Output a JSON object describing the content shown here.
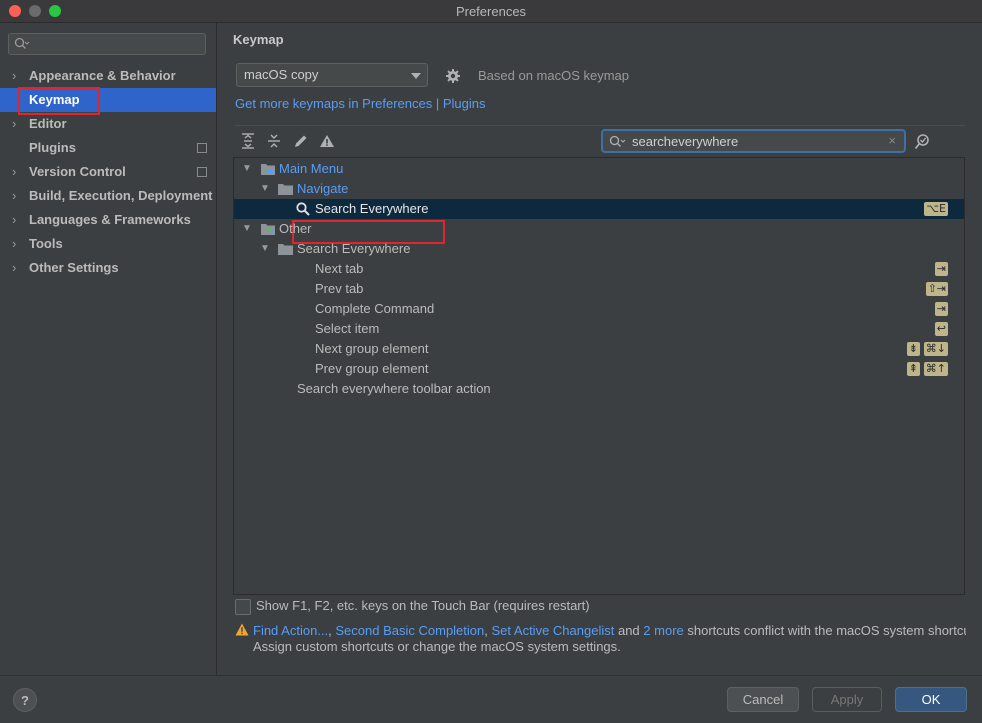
{
  "window": {
    "title": "Preferences"
  },
  "sidebar": {
    "search_placeholder": "",
    "items": [
      {
        "label": "Appearance & Behavior",
        "expandable": true
      },
      {
        "label": "Keymap",
        "selected": true
      },
      {
        "label": "Editor",
        "expandable": true
      },
      {
        "label": "Plugins",
        "external": true
      },
      {
        "label": "Version Control",
        "expandable": true,
        "external": true
      },
      {
        "label": "Build, Execution, Deployment",
        "expandable": true
      },
      {
        "label": "Languages & Frameworks",
        "expandable": true
      },
      {
        "label": "Tools",
        "expandable": true
      },
      {
        "label": "Other Settings",
        "expandable": true
      }
    ]
  },
  "keymap": {
    "heading": "Keymap",
    "selected_keymap": "macOS copy",
    "based_on": "Based on macOS keymap",
    "get_more_link": "Get more keymaps in Preferences | Plugins",
    "search_value": "searcheverywhere"
  },
  "tree": [
    {
      "label": "Main Menu",
      "depth": 0,
      "expanded": true,
      "link": true
    },
    {
      "label": "Navigate",
      "depth": 1,
      "expanded": true,
      "link": true
    },
    {
      "label": "Search Everywhere",
      "depth": 2,
      "selected": true,
      "shortcuts": [
        "⌥E"
      ]
    },
    {
      "label": "Other",
      "depth": 0,
      "expanded": true
    },
    {
      "label": "Search Everywhere",
      "depth": 1,
      "expanded": true
    },
    {
      "label": "Next tab",
      "depth": 2,
      "shortcuts": [
        "⇥"
      ]
    },
    {
      "label": "Prev tab",
      "depth": 2,
      "shortcuts": [
        "⇧⇥"
      ]
    },
    {
      "label": "Complete Command",
      "depth": 2,
      "shortcuts": [
        "⇥"
      ]
    },
    {
      "label": "Select item",
      "depth": 2,
      "shortcuts": [
        "↩"
      ]
    },
    {
      "label": "Next group element",
      "depth": 2,
      "shortcuts": [
        "⇟",
        "⌘↓"
      ]
    },
    {
      "label": "Prev group element",
      "depth": 2,
      "shortcuts": [
        "⇞",
        "⌘↑"
      ]
    },
    {
      "label": "Search everywhere toolbar action",
      "depth": 1
    }
  ],
  "touchbar": {
    "label": "Show F1, F2, etc. keys on the Touch Bar (requires restart)",
    "checked": false
  },
  "conflict": {
    "link1": "Find Action...",
    "link2": "Second Basic Completion",
    "link3": "Set Active Changelist",
    "and_text": "and",
    "more_link": "2 more",
    "suffix": "shortcuts conflict with the macOS system shortcuts.",
    "line2": "Assign custom shortcuts or change the macOS system settings."
  },
  "buttons": {
    "help": "?",
    "cancel": "Cancel",
    "apply": "Apply",
    "ok": "OK"
  },
  "colors": {
    "accent": "#2f65ca",
    "link": "#589df6",
    "selection_row": "#0d293e",
    "highlight_box": "#e0262d"
  }
}
